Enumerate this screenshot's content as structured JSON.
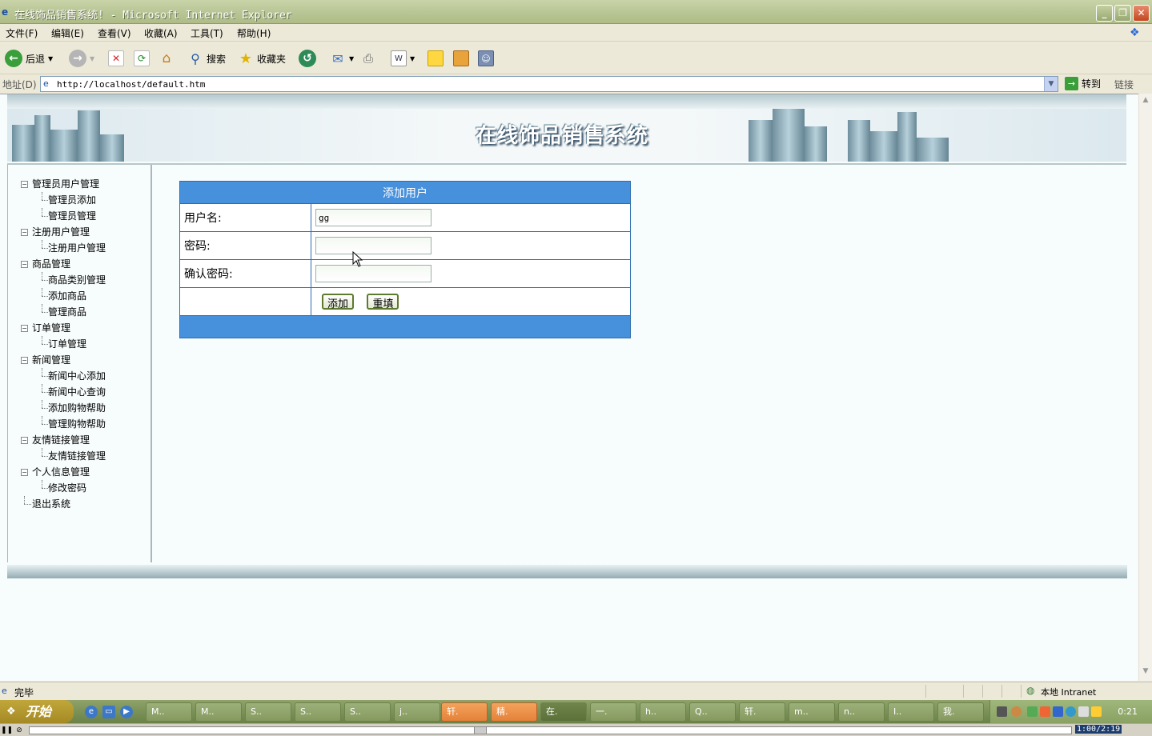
{
  "window": {
    "title": "在线饰品销售系统! - Microsoft Internet Explorer",
    "buttons": {
      "minimize": "_",
      "maximize": "❐",
      "close": "✕"
    }
  },
  "menu": [
    "文件(F)",
    "编辑(E)",
    "查看(V)",
    "收藏(A)",
    "工具(T)",
    "帮助(H)"
  ],
  "toolbar": {
    "back": "后退",
    "search": "搜索",
    "favorites": "收藏夹"
  },
  "address": {
    "label": "地址(D)",
    "url": "http://localhost/default.htm",
    "go": "转到",
    "links": "链接"
  },
  "banner": {
    "title": "在线饰品销售系统"
  },
  "tree": [
    {
      "label": "管理员用户管理",
      "children": [
        "管理员添加",
        "管理员管理"
      ]
    },
    {
      "label": "注册用户管理",
      "children": [
        "注册用户管理"
      ]
    },
    {
      "label": "商品管理",
      "children": [
        "商品类别管理",
        "添加商品",
        "管理商品"
      ]
    },
    {
      "label": "订单管理",
      "children": [
        "订单管理"
      ]
    },
    {
      "label": "新闻管理",
      "children": [
        "新闻中心添加",
        "新闻中心查询",
        "添加购物帮助",
        "管理购物帮助"
      ]
    },
    {
      "label": "友情链接管理",
      "children": [
        "友情链接管理"
      ]
    },
    {
      "label": "个人信息管理",
      "children": [
        "修改密码"
      ]
    },
    {
      "label": "退出系统",
      "children": []
    }
  ],
  "form": {
    "title": "添加用户",
    "username_label": "用户名:",
    "username_value": "gg",
    "password_label": "密码:",
    "confirm_label": "确认密码:",
    "add_button": "添加",
    "reset_button": "重填"
  },
  "status": {
    "text": "完毕",
    "zone": "本地 Intranet"
  },
  "taskbar": {
    "start": "开始",
    "tasks": [
      {
        "label": "M..",
        "state": "normal"
      },
      {
        "label": "M..",
        "state": "normal"
      },
      {
        "label": "S..",
        "state": "normal"
      },
      {
        "label": "S..",
        "state": "normal"
      },
      {
        "label": "S..",
        "state": "normal"
      },
      {
        "label": "j..",
        "state": "normal"
      },
      {
        "label": "轩.",
        "state": "flash"
      },
      {
        "label": "精.",
        "state": "flash"
      },
      {
        "label": "在.",
        "state": "active"
      },
      {
        "label": "一.",
        "state": "normal"
      },
      {
        "label": "h..",
        "state": "normal"
      },
      {
        "label": "Q..",
        "state": "normal"
      },
      {
        "label": "轩.",
        "state": "normal"
      },
      {
        "label": "m..",
        "state": "normal"
      },
      {
        "label": "n..",
        "state": "normal"
      },
      {
        "label": "I..",
        "state": "normal"
      },
      {
        "label": "我.",
        "state": "normal"
      }
    ],
    "clock": "0:21"
  },
  "media": {
    "time": "1:00/2:19"
  },
  "colors": {
    "header_blue": "#4690dc",
    "border_blue": "#2c6cb0"
  }
}
